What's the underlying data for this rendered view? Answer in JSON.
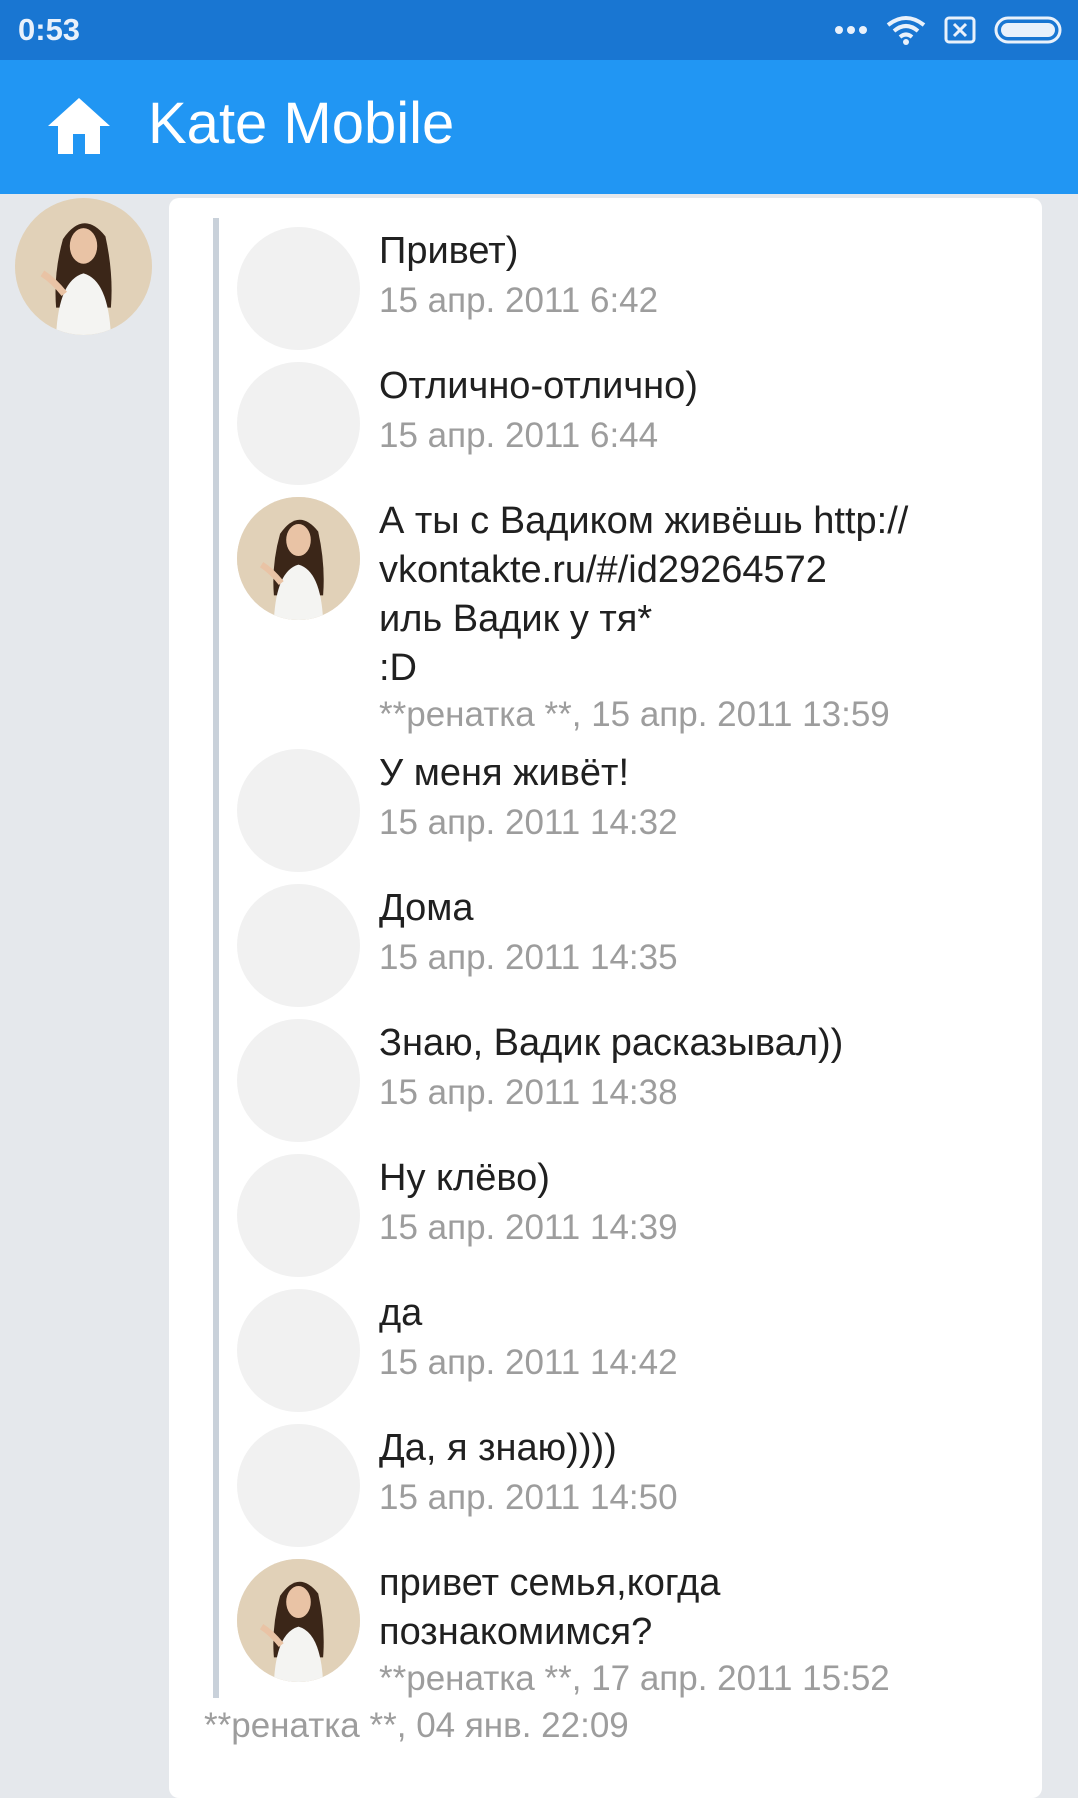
{
  "status_bar": {
    "time": "0:53",
    "icons": [
      "more-dots-icon",
      "wifi-icon",
      "sim-x-icon",
      "battery-icon"
    ]
  },
  "app_bar": {
    "title": "Kate Mobile",
    "icon": "home-icon"
  },
  "colors": {
    "app_bar": "#2196f3",
    "status_bar": "#1976d2",
    "background": "#e5e8ec",
    "meta_text": "#9d9d9d"
  },
  "messages": [
    {
      "text": "Привет)",
      "meta": "15 апр. 2011 6:42",
      "has_photo": false
    },
    {
      "text": "Отлично-отлично)",
      "meta": "15 апр. 2011 6:44",
      "has_photo": false
    },
    {
      "text": "А ты с Вадиком живёшь  http://\nvkontakte.ru/#/id29264572\nиль Вадик у тя*\n:D",
      "meta": "**ренатка **, 15 апр. 2011 13:59",
      "has_photo": true
    },
    {
      "text": "У меня живёт!",
      "meta": "15 апр. 2011 14:32",
      "has_photo": false
    },
    {
      "text": "Дома",
      "meta": "15 апр. 2011 14:35",
      "has_photo": false
    },
    {
      "text": "Знаю, Вадик расказывал))",
      "meta": "15 апр. 2011 14:38",
      "has_photo": false
    },
    {
      "text": "Ну клёво)",
      "meta": "15 апр. 2011 14:39",
      "has_photo": false
    },
    {
      "text": "да",
      "meta": "15 апр. 2011 14:42",
      "has_photo": false
    },
    {
      "text": "Да, я знаю))))",
      "meta": "15 апр. 2011 14:50",
      "has_photo": false
    },
    {
      "text": "привет семья,когда\nпознакомимся?",
      "meta": "**ренатка **, 17 апр. 2011 15:52",
      "has_photo": true
    }
  ],
  "footer": {
    "meta": "**ренатка **, 04 янв. 22:09"
  }
}
